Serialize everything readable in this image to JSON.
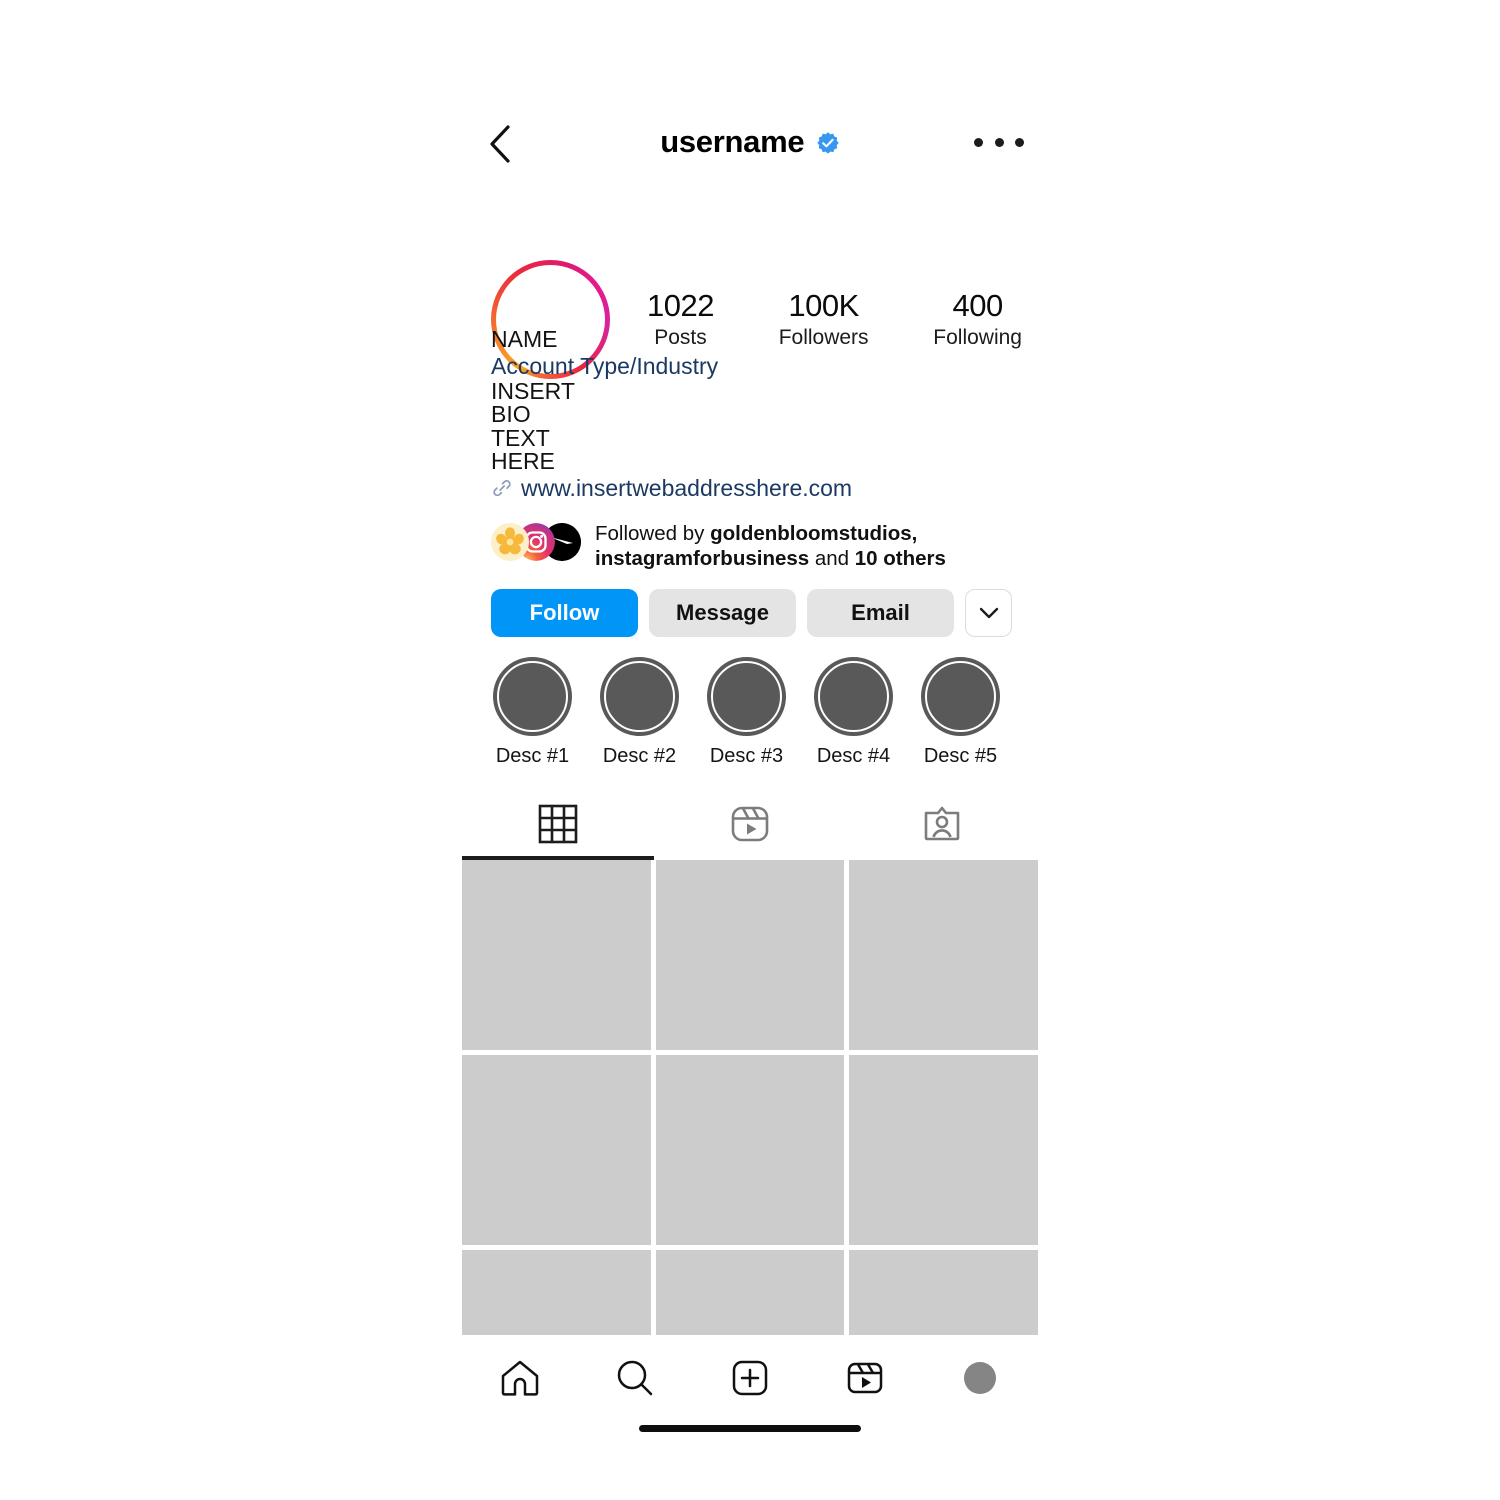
{
  "app": {
    "platform": "instagram-profile-mockup"
  },
  "topbar": {
    "back_icon": "chevron-left-icon",
    "username": "username",
    "verified_icon": "verified-badge-icon",
    "menu_icon": "more-options-icon"
  },
  "profile": {
    "avatar_icon": "profile-avatar-story-ring",
    "stats": [
      {
        "value": "1022",
        "label": "Posts"
      },
      {
        "value": "100K",
        "label": "Followers"
      },
      {
        "value": "400",
        "label": "Following"
      }
    ],
    "name": "NAME",
    "category": "Account Type/Industry",
    "bio_lines": [
      "INSERT",
      "BIO",
      "TEXT",
      "HERE"
    ],
    "link_icon": "link-chain-icon",
    "website": "www.insertwebaddresshere.com"
  },
  "followed_by": {
    "prefix": "Followed by ",
    "names": "goldenbloomstudios, instagramforbusiness",
    "middle": " and ",
    "others_count": "10 others",
    "avatars": [
      "flower-avatar-icon",
      "instagram-glyph-avatar-icon",
      "black-circle-avatar-icon"
    ]
  },
  "actions": {
    "follow_label": "Follow",
    "message_label": "Message",
    "email_label": "Email",
    "dropdown_icon": "chevron-down-icon"
  },
  "highlights": [
    {
      "label": "Desc #1"
    },
    {
      "label": "Desc #2"
    },
    {
      "label": "Desc #3"
    },
    {
      "label": "Desc #4"
    },
    {
      "label": "Desc #5"
    }
  ],
  "tabs": [
    {
      "icon": "grid-icon",
      "active": true
    },
    {
      "icon": "reels-icon",
      "active": false
    },
    {
      "icon": "tagged-icon",
      "active": false
    }
  ],
  "grid": {
    "rows": 3,
    "columns": 3,
    "cell_count": 9
  },
  "bottom_nav": [
    {
      "icon": "home-icon"
    },
    {
      "icon": "search-icon"
    },
    {
      "icon": "create-plus-icon"
    },
    {
      "icon": "reels-icon"
    },
    {
      "icon": "profile-avatar-icon"
    }
  ],
  "colors": {
    "follow_blue": "#0095f6",
    "button_grey": "#e4e4e4",
    "link_blue": "#1b3a63",
    "tile_grey": "#cccccc",
    "highlight_grey": "#595959"
  }
}
